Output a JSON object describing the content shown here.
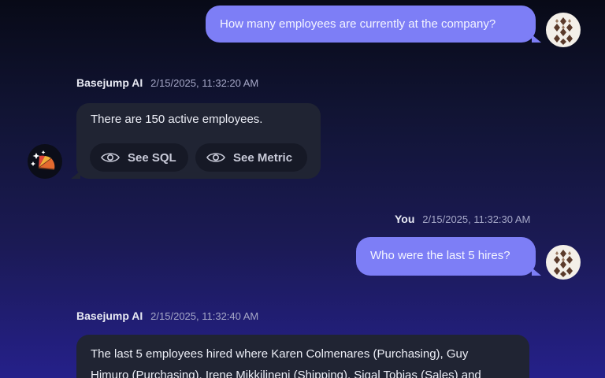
{
  "messages": {
    "user_1": {
      "text": "How many employees are currently at the company?"
    },
    "ai_1": {
      "sender": "Basejump AI",
      "timestamp": "2/15/2025, 11:32:20 AM",
      "text": "There are 150 active employees.",
      "see_sql_label": "See SQL",
      "see_metric_label": "See Metric"
    },
    "user_2": {
      "sender": "You",
      "timestamp": "2/15/2025, 11:32:30 AM",
      "text": "Who were the last 5 hires?"
    },
    "ai_2": {
      "sender": "Basejump AI",
      "timestamp": "2/15/2025, 11:32:40 AM",
      "text_line_1": "The last 5 employees hired where Karen Colmenares (Purchasing), Guy",
      "text_line_2": "Himuro (Purchasing), Irene Mikkilineni (Shipping), Sigal Tobias (Sales) and"
    }
  },
  "icons": {
    "user_avatar": "checkered-pattern-avatar",
    "ai_avatar": "sparkles-fan-avatar",
    "see": "eye-icon"
  },
  "colors": {
    "user_bubble": "#7d7ef6",
    "ai_bubble": "#202433",
    "chip": "#161926"
  }
}
